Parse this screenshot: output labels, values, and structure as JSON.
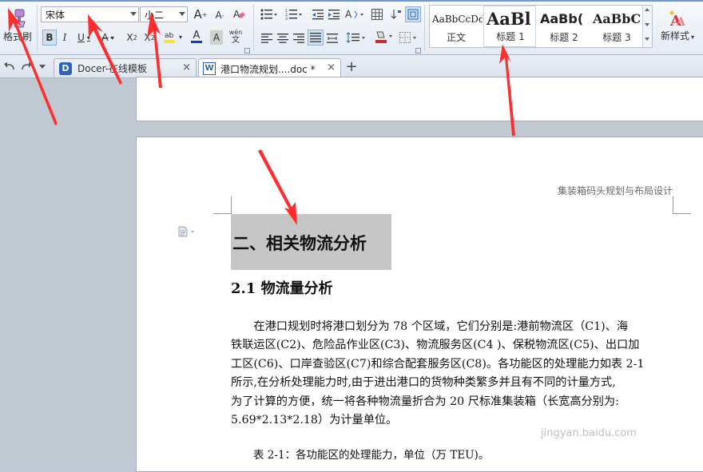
{
  "ribbon": {
    "format_painter": {
      "label": "格式刷",
      "icon": "paintbrush-icon"
    },
    "font": {
      "name_value": "宋体",
      "size_value": "小二",
      "grow_label": "A",
      "shrink_label": "A",
      "bold": "B",
      "italic": "I",
      "underline": "U",
      "strike": "A",
      "superscript": "X",
      "superscript_sup": "2",
      "subscript": "X",
      "subscript_sub": "2",
      "highlight_color": "#f5e23a",
      "font_color_letter": "A",
      "font_color": "#0b3fb3",
      "char_shading": "A",
      "phonetic_top": "wén",
      "phonetic_bottom": "文"
    },
    "styles": [
      {
        "sample": "AaBbCcDd",
        "name": "正文"
      },
      {
        "sample": "AaBl",
        "name": "标题 1"
      },
      {
        "sample": "AaBb(",
        "name": "标题 2"
      },
      {
        "sample": "AaBbC",
        "name": "标题 3"
      }
    ],
    "new_style_label": "新样式"
  },
  "tabs": [
    {
      "label": "Docer-在线模板",
      "icon": "docer-icon",
      "close": "×"
    },
    {
      "label": "港口物流规划....doc *",
      "icon": "word-doc-icon",
      "close": "×"
    }
  ],
  "new_tab": "+",
  "document": {
    "running_header": "集装箱码头规划与布局设计",
    "heading1": "二、相关物流分析",
    "heading2": "2.1 物流量分析",
    "paragraph_lines": [
      "　　在港口规划时将港口划分为 78 个区域，它们分别是:港前物流区（C1)、海",
      "铁联运区(C2)、危险品作业区(C3)、物流服务区(C4 )、保税物流区(C5)、出口加",
      "工区(C6)、口岸查验区(C7)和综合配套服务区(C8)。各功能区的处理能力如表 2-1",
      "所示,在分析处理能力时,由于进出港口的货物种类繁多并且有不同的计量方式,",
      "为了计算的方便，统一将各种物流量折合为 20 尺标准集装箱（长宽高分别为:",
      "5.69*2.13*2.18）为计量单位。"
    ],
    "table_caption": "表 2-1：各功能区的处理能力，单位（万 TEU)。"
  },
  "watermark": "jingyan.baidu.com",
  "colors": {
    "annotation_arrow": "#ff2d2d",
    "heading_selection": "#c6c6c6",
    "ribbon_accent": "#6f99cf"
  }
}
